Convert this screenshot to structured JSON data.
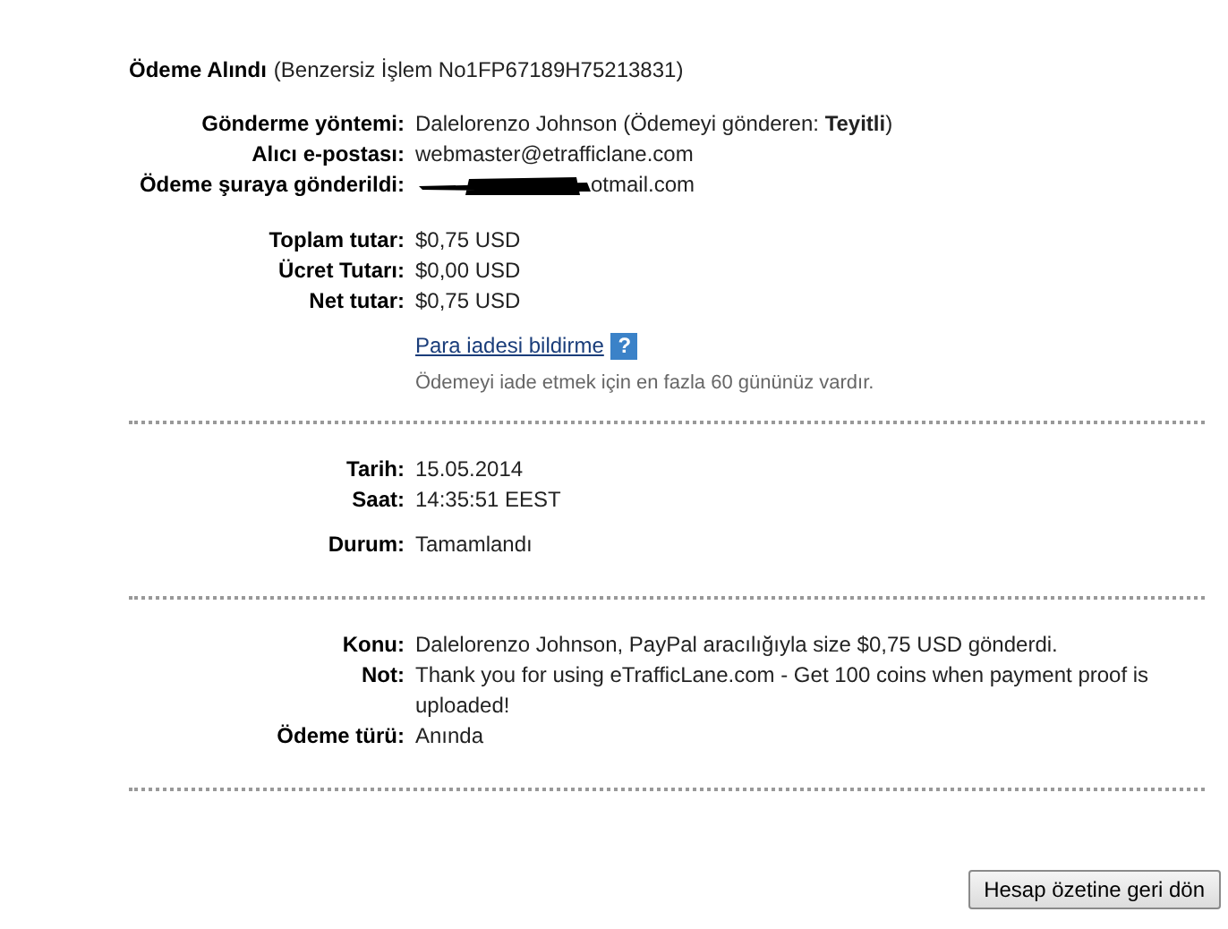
{
  "header": {
    "title": "Ödeme Alındı",
    "reference": "(Benzersiz İşlem No1FP67189H75213831)"
  },
  "sections": [
    {
      "blocks": [
        [
          {
            "kind": "text",
            "label": "Gönderme yöntemi:",
            "value": "Dalelorenzo Johnson (Ödemeyi gönderen: **Teyitli**)"
          },
          {
            "kind": "text",
            "label": "Alıcı e-postası:",
            "value": "webmaster@etrafficlane.com"
          },
          {
            "kind": "redacted",
            "label": "Ödeme şuraya gönderildi:",
            "value": "otmail.com"
          }
        ],
        [
          {
            "kind": "text",
            "label": "Toplam tutar:",
            "value": "$0,75 USD"
          },
          {
            "kind": "text",
            "label": "Ücret Tutarı:",
            "value": "$0,00 USD"
          },
          {
            "kind": "text",
            "label": "Net tutar:",
            "value": "$0,75 USD"
          }
        ]
      ],
      "link": "Para iadesi bildirme",
      "help": "?",
      "note": "Ödemeyi iade etmek için en fazla 60 gününüz vardır."
    },
    {
      "blocks": [
        [
          {
            "kind": "text",
            "label": "Tarih:",
            "value": "15.05.2014"
          },
          {
            "kind": "text",
            "label": "Saat:",
            "value": "14:35:51 EEST"
          }
        ],
        [
          {
            "kind": "text",
            "label": "Durum:",
            "value": "Tamamlandı"
          }
        ]
      ]
    },
    {
      "blocks": [
        [
          {
            "kind": "text",
            "label": "Konu:",
            "value": "Dalelorenzo Johnson, PayPal aracılığıyla size $0,75 USD gönderdi."
          },
          {
            "kind": "text",
            "label": "Not:",
            "value": "Thank you for using eTrafficLane.com - Get 100 coins when payment proof is uploaded!"
          },
          {
            "kind": "text",
            "label": "Ödeme türü:",
            "value": "Anında"
          }
        ]
      ]
    }
  ],
  "button": "Hesap özetine geri dön"
}
